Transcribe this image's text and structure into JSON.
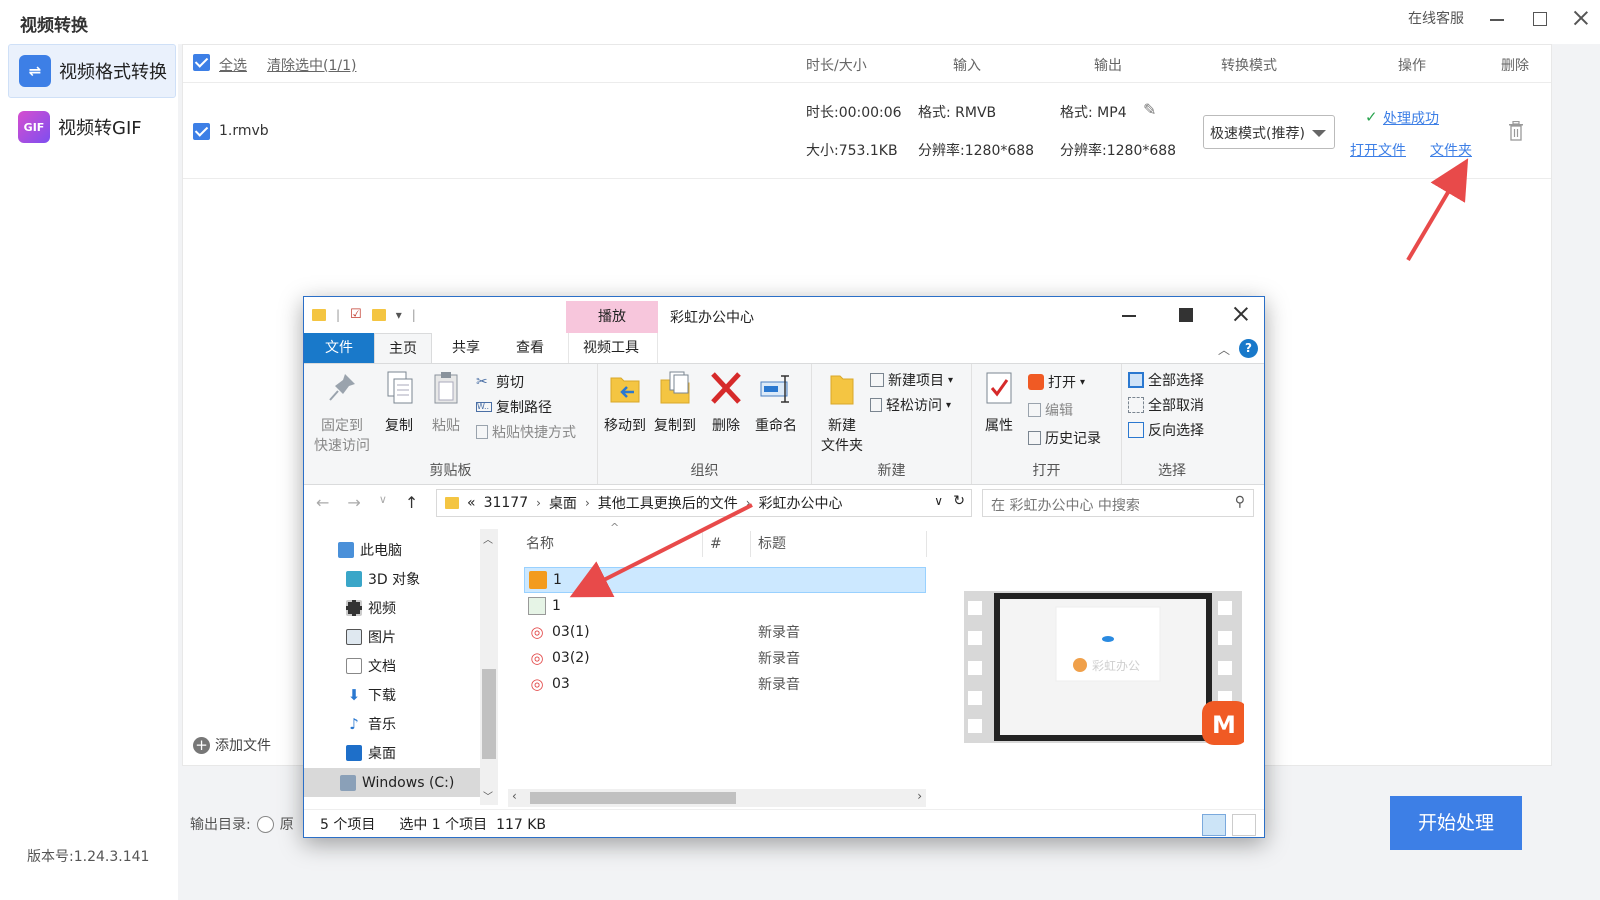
{
  "app": {
    "title": "视频转换",
    "online_service": "在线客服",
    "version": "版本号:1.24.3.141"
  },
  "sidebar": {
    "items": [
      {
        "label": "视频格式转换",
        "icon": "convert-arrows-icon",
        "active": true
      },
      {
        "label": "视频转GIF",
        "icon": "gif-icon",
        "active": false
      }
    ]
  },
  "list": {
    "select_all": "全选",
    "clear_selection": "清除选中(1/1)",
    "columns": {
      "duration_size": "时长/大小",
      "input": "输入",
      "output": "输出",
      "mode": "转换模式",
      "action": "操作",
      "delete": "删除"
    },
    "rows": [
      {
        "filename": "1.rmvb",
        "duration": "时长:00:00:06",
        "size": "大小:753.1KB",
        "in_format": "格式: RMVB",
        "in_resolution": "分辨率:1280*688",
        "out_format": "格式: MP4",
        "out_resolution": "分辨率:1280*688",
        "mode": "极速模式(推荐)",
        "status": "处理成功",
        "open_file": "打开文件",
        "open_folder": "文件夹"
      }
    ],
    "add_file": "添加文件"
  },
  "output": {
    "label": "输出目录:",
    "option": "原"
  },
  "start_button": "开始处理",
  "explorer": {
    "title": "彩虹办公中心",
    "contextual_tab": "播放",
    "tabs": {
      "file": "文件",
      "home": "主页",
      "share": "共享",
      "view": "查看",
      "video_tools": "视频工具"
    },
    "ribbon": {
      "clipboard": {
        "label": "剪贴板",
        "pin": "固定到\n快速访问",
        "pin_l1": "固定到",
        "pin_l2": "快速访问",
        "copy": "复制",
        "paste": "粘贴",
        "cut": "剪切",
        "copy_path": "复制路径",
        "paste_shortcut": "粘贴快捷方式"
      },
      "organize": {
        "label": "组织",
        "move_to": "移动到",
        "copy_to": "复制到",
        "delete": "删除",
        "rename": "重命名"
      },
      "new": {
        "label": "新建",
        "new_folder_l1": "新建",
        "new_folder_l2": "文件夹",
        "new_item": "新建项目",
        "easy_access": "轻松访问"
      },
      "open": {
        "label": "打开",
        "properties": "属性",
        "open": "打开",
        "edit": "编辑",
        "history": "历史记录"
      },
      "select": {
        "label": "选择",
        "select_all": "全部选择",
        "select_none": "全部取消",
        "invert": "反向选择"
      }
    },
    "address": {
      "overflow": "«",
      "crumbs": [
        "31177",
        "桌面",
        "其他工具更换后的文件",
        "彩虹办公中心"
      ]
    },
    "search_placeholder": "在 彩虹办公中心 中搜索",
    "tree": [
      {
        "label": "此电脑",
        "icon": "computer-icon"
      },
      {
        "label": "3D 对象",
        "icon": "3d-objects-icon"
      },
      {
        "label": "视频",
        "icon": "videos-icon"
      },
      {
        "label": "图片",
        "icon": "pictures-icon"
      },
      {
        "label": "文档",
        "icon": "documents-icon"
      },
      {
        "label": "下载",
        "icon": "downloads-icon"
      },
      {
        "label": "音乐",
        "icon": "music-icon"
      },
      {
        "label": "桌面",
        "icon": "desktop-icon"
      },
      {
        "label": "Windows (C:)",
        "icon": "drive-icon"
      }
    ],
    "columns": {
      "name": "名称",
      "number": "#",
      "title": "标题"
    },
    "files": [
      {
        "name": "1",
        "title": "",
        "icon": "video-file-icon",
        "selected": true
      },
      {
        "name": "1",
        "title": "",
        "icon": "image-file-icon",
        "selected": false
      },
      {
        "name": "03(1)",
        "title": "新录音",
        "icon": "audio-file-icon",
        "selected": false
      },
      {
        "name": "03(2)",
        "title": "新录音",
        "icon": "audio-file-icon",
        "selected": false
      },
      {
        "name": "03",
        "title": "新录音",
        "icon": "audio-file-icon",
        "selected": false
      }
    ],
    "preview": {
      "watermark": "彩虹办公"
    },
    "status": {
      "count": "5 个项目",
      "selection": "选中 1 个项目  117 KB"
    }
  },
  "colors": {
    "accent": "#3d7fe6",
    "annotation_arrow": "#e84a4a",
    "explorer_file_tab": "#1979ca",
    "contextual_tab": "#f7c6dc",
    "selection": "#cce8ff"
  }
}
